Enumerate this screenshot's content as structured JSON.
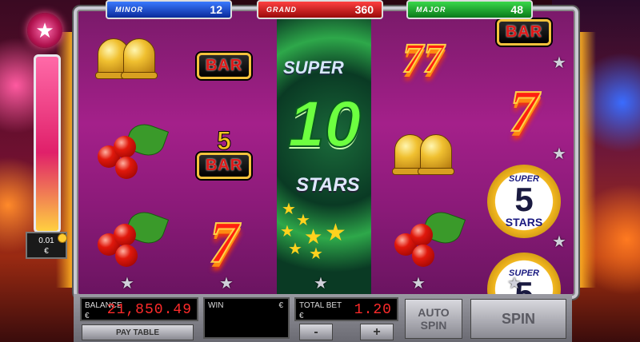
{
  "jackpots": {
    "minor": {
      "label": "MINOR",
      "value": "12",
      "color": "#1a4ad0"
    },
    "grand": {
      "label": "GRAND",
      "value": "360",
      "color": "#d01818"
    },
    "major": {
      "label": "MAJOR",
      "value": "48",
      "color": "#18a82a"
    }
  },
  "meter": {
    "bet": "0.01",
    "currency": "€"
  },
  "reels": [
    [
      "bell",
      "cherries",
      "cherries"
    ],
    [
      "bar",
      "5 bar",
      "seven"
    ],
    [
      "super 10 stars"
    ],
    [
      "double seven",
      "bell",
      "cherries"
    ],
    [
      "bar",
      "seven",
      "super 5 stars",
      "super 5 stars"
    ]
  ],
  "symbols": {
    "bar_label": "BAR",
    "five_bar_num": "5",
    "five_bar_label": "BAR",
    "seven_label": "7",
    "super10": {
      "super": "SUPER",
      "ten": "10",
      "stars": "STARS"
    },
    "super5": {
      "super": "SUPER",
      "num": "5",
      "stars": "STARS"
    }
  },
  "controls": {
    "balance": {
      "label": "BALANCE",
      "currency": "€",
      "value": "21,850.49"
    },
    "win": {
      "label": "WIN",
      "currency": "€",
      "value": ""
    },
    "total_bet": {
      "label": "TOTAL BET",
      "currency": "€",
      "value": "1.20"
    },
    "paytable_label": "PAY TABLE",
    "minus_label": "-",
    "plus_label": "+",
    "auto_spin_label": "AUTO SPIN",
    "spin_label": "SPIN"
  }
}
